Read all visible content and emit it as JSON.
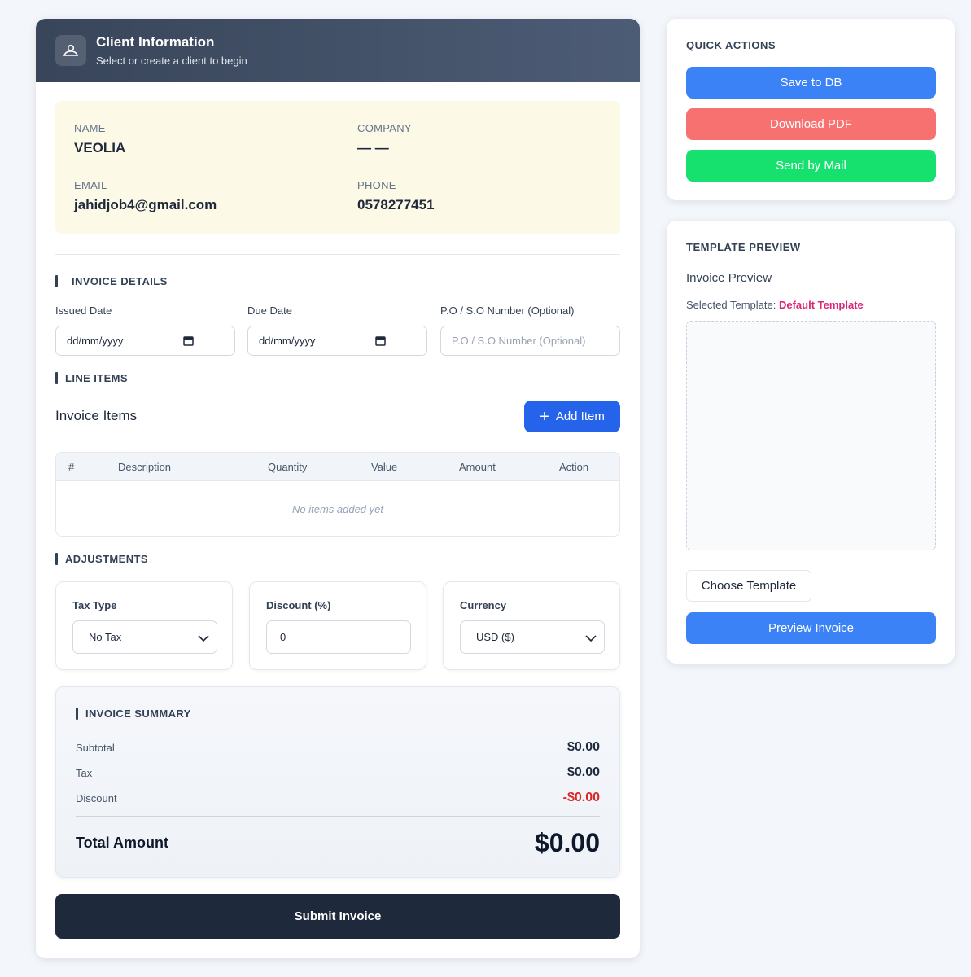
{
  "colors": {
    "primary_blue": "#2563eb",
    "side_blue": "#3b82f6",
    "danger_red": "#f87171",
    "success_green": "#16e06e",
    "dark_navy": "#1e293b",
    "pink_accent": "#db2777",
    "client_box_bg": "#fdf9e7"
  },
  "header": {
    "icon": "user-cloud-icon",
    "title": "Client Information",
    "subtitle": "Select or create a client to begin"
  },
  "client": {
    "name_label": "NAME",
    "name": "VEOLIA",
    "company_label": "COMPANY",
    "company": "— —",
    "email_label": "EMAIL",
    "email": "jahidjob4@gmail.com",
    "phone_label": "PHONE",
    "phone": "0578277451"
  },
  "invoice_details": {
    "title": "INVOICE DETAILS",
    "issued_label": "Issued Date",
    "issued_value": "dd/mm/yyyy",
    "due_label": "Due Date",
    "due_value": "dd/mm/yyyy",
    "po_label": "P.O / S.O Number (Optional)",
    "po_placeholder": "P.O / S.O Number (Optional)"
  },
  "line_items": {
    "title": "LINE ITEMS",
    "heading": "Invoice Items",
    "add_button": "Add Item",
    "columns": [
      "#",
      "Description",
      "Quantity",
      "Value",
      "Amount",
      "Action"
    ],
    "empty_text": "No items added yet"
  },
  "adjustments": {
    "title": "ADJUSTMENTS",
    "tax_label": "Tax Type",
    "tax_value": "No Tax",
    "discount_label": "Discount (%)",
    "discount_value": "0",
    "currency_label": "Currency",
    "currency_value": "USD ($)"
  },
  "summary": {
    "title": "INVOICE SUMMARY",
    "subtotal_label": "Subtotal",
    "subtotal": "$0.00",
    "tax_label": "Tax",
    "tax": "$0.00",
    "discount_label": "Discount",
    "discount": "-$0.00",
    "total_label": "Total Amount",
    "total": "$0.00"
  },
  "submit_button": "Submit Invoice",
  "quick_actions": {
    "title": "QUICK ACTIONS",
    "save": "Save to DB",
    "download": "Download PDF",
    "mail": "Send by Mail"
  },
  "template_preview": {
    "title": "TEMPLATE PREVIEW",
    "heading": "Invoice Preview",
    "selected_label": "Selected Template:",
    "selected_value": "Default Template",
    "choose_button": "Choose Template",
    "preview_button": "Preview Invoice"
  }
}
